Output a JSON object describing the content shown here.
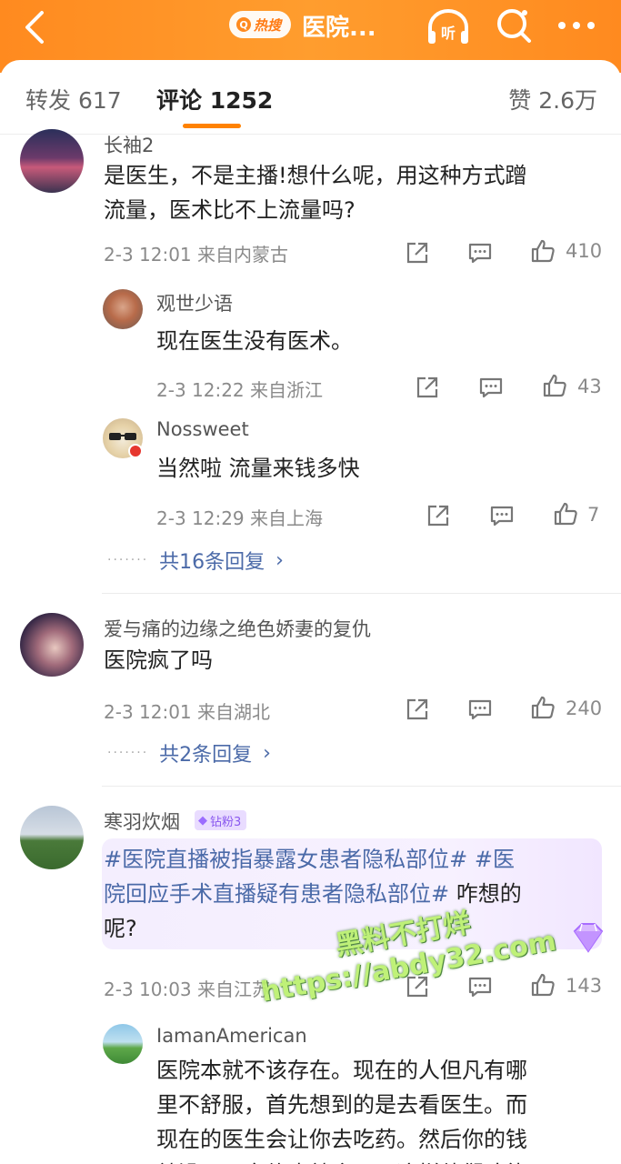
{
  "header": {
    "hot_label": "热搜",
    "title": "医院...",
    "colors": {
      "accent": "#ff8a1f",
      "link": "#4b6aa8",
      "tab_indicator": "#ff8200"
    }
  },
  "tabs": {
    "repost": "转发 617",
    "comment": "评论 1252",
    "like": "赞 2.6万"
  },
  "comments": [
    {
      "user": "长袖2",
      "text_lines": [
        "是医生，不是主播!想什么呢，用这种方式蹭",
        "流量，医术比不上流量吗?"
      ],
      "meta": "2-3 12:01  来自内蒙古",
      "likes": "410",
      "replies": [
        {
          "user": "观世少语",
          "text": "现在医生没有医术。",
          "meta": "2-3 12:22  来自浙江",
          "likes": "43"
        },
        {
          "user": "Nossweet",
          "text": "当然啦 流量来钱多快",
          "meta": "2-3 12:29  来自上海",
          "likes": "7"
        }
      ],
      "more_replies": "共16条回复"
    },
    {
      "user": "爱与痛的边缘之绝色娇妻的复仇",
      "text": "医院疯了吗",
      "meta": "2-3 12:01  来自湖北",
      "likes": "240",
      "more_replies": "共2条回复"
    },
    {
      "user": "寒羽炊烟",
      "fan_badge": "钻粉3",
      "line1_tag": "#医院直播被指暴露女患者隐私部位#",
      "line1_tag2": " #医",
      "line2_tag": "院回应手术直播疑有患者隐私部位#",
      "line2_rest": "  咋想的",
      "line3": "呢?",
      "meta": "2-3 10:03  来自江苏",
      "likes": "143",
      "replies": [
        {
          "user": "IamanAmerican",
          "text_lines": [
            "医院本就不该存在。现在的人但凡有哪",
            "里不舒服，首先想到的是去看医生。而",
            "现在的医生会让你去吃药。然后你的钱",
            "就没了，身体也就废了，这样他们才能"
          ]
        }
      ]
    }
  ],
  "watermark": {
    "line1": "黑料不打烊",
    "line2": "https://abdy32.com"
  }
}
